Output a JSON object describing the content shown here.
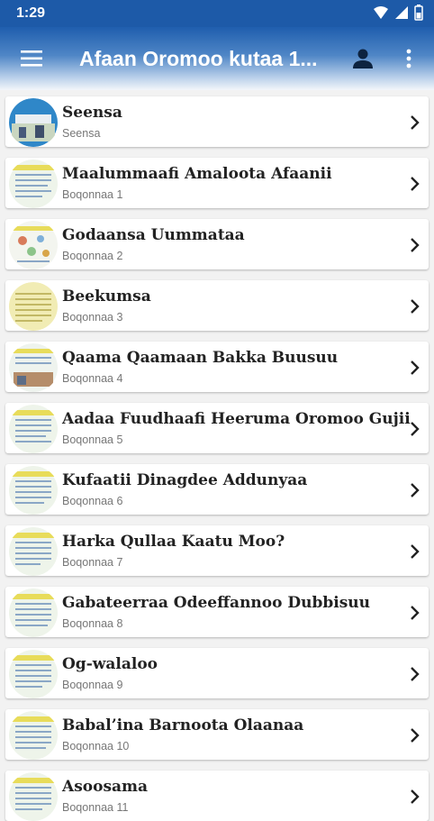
{
  "status": {
    "time": "1:29"
  },
  "appbar": {
    "title": "Afaan Oromoo kutaa 1..."
  },
  "chapters": [
    {
      "title": "Seensa",
      "subtitle": "Seensa"
    },
    {
      "title": "Maalummaafi Amaloota Afaanii",
      "subtitle": "Boqonnaa 1"
    },
    {
      "title": "Godaansa Uummataa",
      "subtitle": "Boqonnaa 2"
    },
    {
      "title": "Beekumsa",
      "subtitle": "Boqonnaa 3"
    },
    {
      "title": "Qaama Qaamaan Bakka Buusuu",
      "subtitle": "Boqonnaa 4"
    },
    {
      "title": "Aadaa Fuudhaafi Heeruma Oromoo Gujii",
      "subtitle": "Boqonnaa 5"
    },
    {
      "title": "Kufaatii Dinagdee Addunyaa",
      "subtitle": "Boqonnaa 6"
    },
    {
      "title": "Harka Qullaa Kaatu Moo?",
      "subtitle": "Boqonnaa 7"
    },
    {
      "title": "Gabateerraa Odeeffannoo Dubbisuu",
      "subtitle": "Boqonnaa 8"
    },
    {
      "title": "Og-walaloo",
      "subtitle": "Boqonnaa 9"
    },
    {
      "title": "Babal’ina Barnoota Olaanaa",
      "subtitle": "Boqonnaa 10"
    },
    {
      "title": "Asoosama",
      "subtitle": "Boqonnaa 11"
    }
  ],
  "icons": {
    "menu": "hamburger-icon",
    "account": "account-icon",
    "more": "more-vert-icon",
    "chevron": "chevron-right-icon",
    "wifi": "wifi-icon",
    "signal": "signal-icon",
    "battery": "battery-icon"
  },
  "colors": {
    "status_bar": "#1d5aa8",
    "app_bar_top": "#1f5eae",
    "background": "#f2f2f2"
  }
}
